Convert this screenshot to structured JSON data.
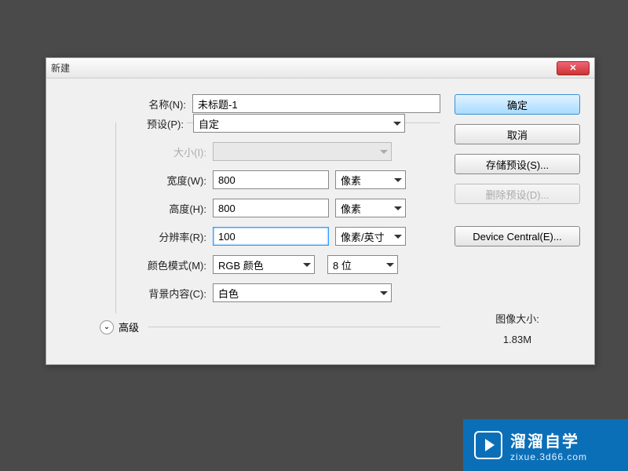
{
  "dialog": {
    "title": "新建",
    "close_glyph": "✕"
  },
  "labels": {
    "name": "名称(N):",
    "preset": "预设(P):",
    "size": "大小(I):",
    "width": "宽度(W):",
    "height": "高度(H):",
    "resolution": "分辨率(R):",
    "color_mode": "颜色模式(M):",
    "background": "背景内容(C):",
    "advanced": "高级"
  },
  "values": {
    "name": "未标题-1",
    "preset": "自定",
    "width": "800",
    "height": "800",
    "resolution": "100",
    "color_mode": "RGB 颜色",
    "bit_depth": "8 位",
    "background": "白色"
  },
  "units": {
    "width": "像素",
    "height": "像素",
    "resolution": "像素/英寸"
  },
  "buttons": {
    "ok": "确定",
    "cancel": "取消",
    "save_preset": "存储预设(S)...",
    "delete_preset": "删除预设(D)...",
    "device_central": "Device Central(E)..."
  },
  "info": {
    "label": "图像大小:",
    "value": "1.83M"
  },
  "watermark": {
    "title": "溜溜自学",
    "url": "zixue.3d66.com"
  }
}
